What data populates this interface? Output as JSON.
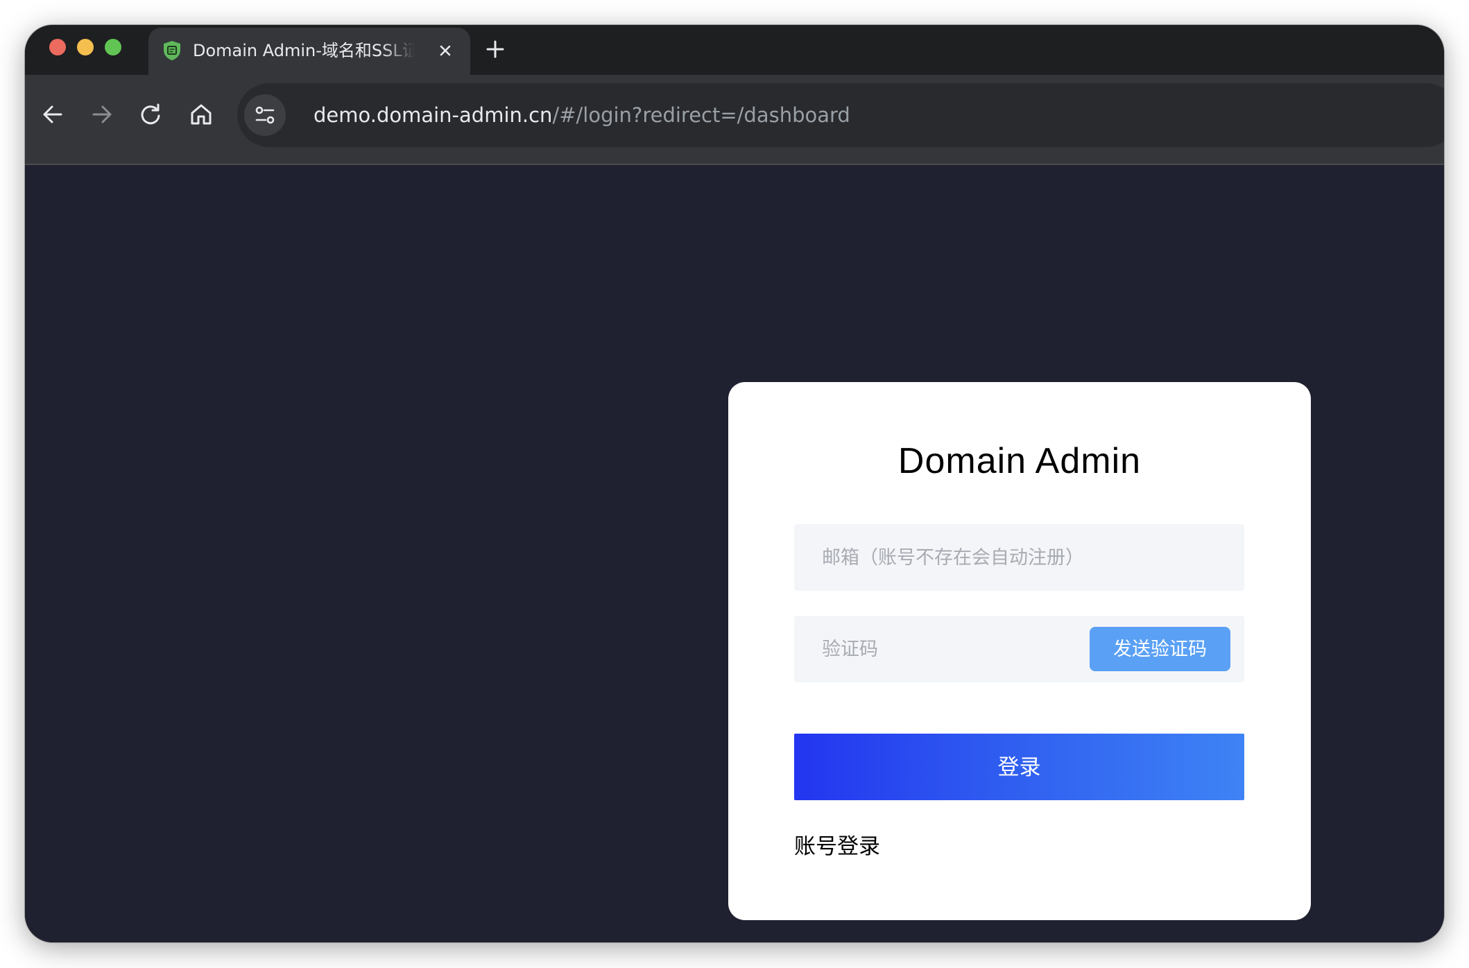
{
  "browser": {
    "tab_title": "Domain Admin-域名和SSL证书",
    "url_host": "demo.domain-admin.cn",
    "url_path": "/#/login?redirect=/dashboard",
    "colors": {
      "tab_strip": "#1e1f21",
      "active_tab": "#34363a",
      "favicon": "#5fb85a"
    },
    "icons": {
      "favicon": "shield-icon",
      "close": "close-icon",
      "new_tab": "plus-icon",
      "back": "arrow-left-icon",
      "forward": "arrow-right-icon",
      "reload": "reload-icon",
      "home": "home-icon",
      "site_info": "tune-icon"
    }
  },
  "login": {
    "title": "Domain Admin",
    "email_placeholder": "邮箱（账号不存在会自动注册）",
    "code_placeholder": "验证码",
    "send_code_label": "发送验证码",
    "submit_label": "登录",
    "account_login_label": "账号登录",
    "colors": {
      "page_background": "#1f2130",
      "card_background": "#ffffff",
      "input_background": "#f3f5f8",
      "send_code_button": "#5aa0f5",
      "submit_gradient_start": "#2335f0",
      "submit_gradient_end": "#3e83f5"
    }
  }
}
